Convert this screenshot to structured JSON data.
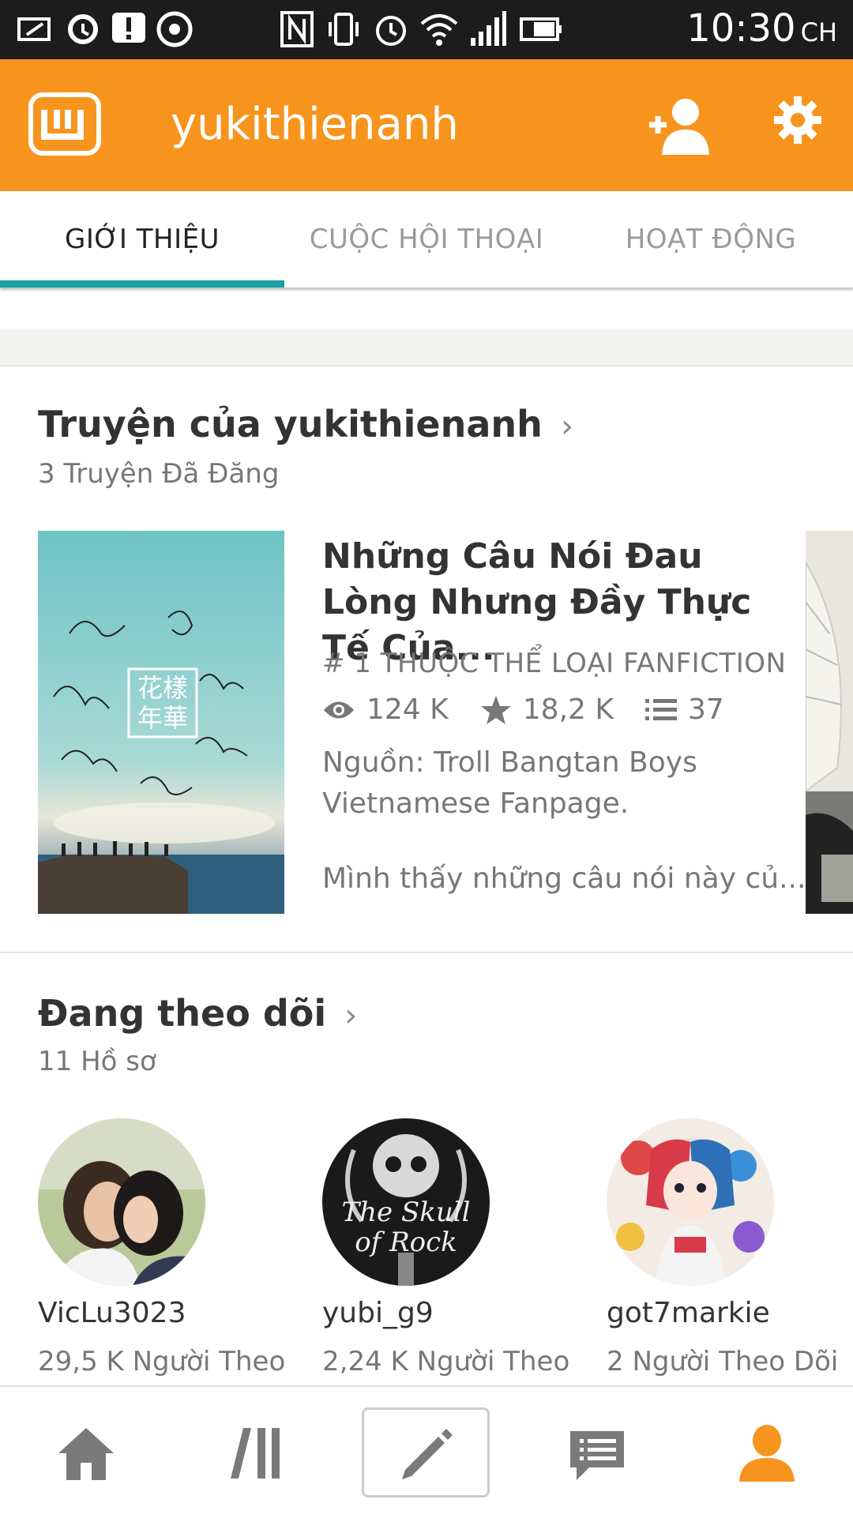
{
  "status_bar": {
    "time": "10:30",
    "period": "CH",
    "icons": [
      "battery-saver-icon",
      "sync-icon",
      "alert-icon",
      "chrome-icon",
      "nfc-icon",
      "vibrate-icon",
      "alarm-icon",
      "wifi-icon",
      "signal-icon",
      "battery-icon"
    ]
  },
  "app_bar": {
    "username": "yukithienanh",
    "icons": [
      "wattpad-logo",
      "add-person-icon",
      "settings-icon"
    ],
    "color": "#f7941d"
  },
  "tabs": [
    {
      "label": "GIỚI THIỆU",
      "active": true
    },
    {
      "label": "CUỘC HỘI THOẠI",
      "active": false
    },
    {
      "label": "HOẠT ĐỘNG",
      "active": false
    }
  ],
  "accent_color": "#17a2a4",
  "stories": {
    "title": "Truyện của yukithienanh",
    "subtitle": "3 Truyện Đã Đăng",
    "items": [
      {
        "title": "Những Câu Nói Đau Lòng Nhưng Đầy Thực Tế Của...",
        "rank": "# 1 THUỘC THỂ LOẠI FANFICTION",
        "reads": "124 K",
        "votes": "18,2 K",
        "parts": "37",
        "source": "Nguồn: Troll Bangtan Boys Vietnamese Fanpage.",
        "description": "Mình thấy những câu nói này củ...",
        "cover_text": "花樣年華"
      }
    ]
  },
  "following": {
    "title": "Đang theo dõi",
    "subtitle": "11 Hồ sơ",
    "users": [
      {
        "name": "VicLu3023",
        "followers": "29,5 K Người Theo"
      },
      {
        "name": "yubi_g9",
        "followers": "2,24 K Người Theo"
      },
      {
        "name": "got7markie",
        "followers": "2 Người Theo Dõi"
      }
    ]
  },
  "bottom_nav": {
    "items": [
      "home-icon",
      "library-icon",
      "write-icon",
      "messages-icon",
      "profile-icon"
    ],
    "active": "profile-icon"
  }
}
